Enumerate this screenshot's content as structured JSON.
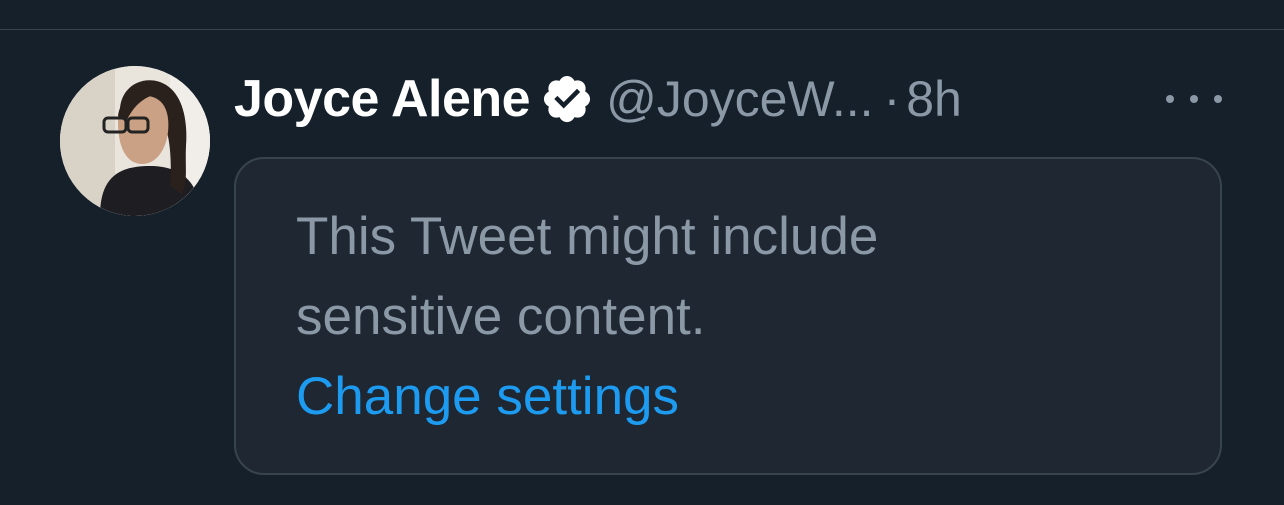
{
  "tweet": {
    "display_name": "Joyce Alene",
    "handle": "@JoyceW...",
    "separator": "·",
    "timestamp": "8h",
    "verified": true,
    "sensitive_notice": {
      "message": "This Tweet might include sensitive content.",
      "link_label": "Change settings"
    }
  },
  "icons": {
    "verified": "verified-badge-icon",
    "more": "more-horizontal-icon"
  },
  "colors": {
    "background": "#15202b",
    "card": "#1e2732",
    "border": "#38444d",
    "muted_text": "#8b98a5",
    "link": "#1d9bf0",
    "name": "#ffffff"
  }
}
